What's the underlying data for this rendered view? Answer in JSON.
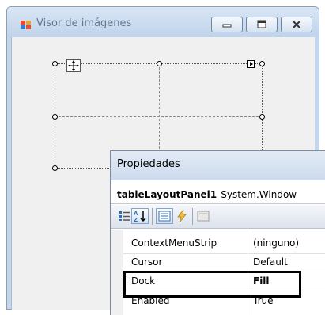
{
  "window": {
    "title": "Visor de imágenes",
    "buttons": [
      "minimize",
      "maximize",
      "close"
    ]
  },
  "designer": {
    "control": "tableLayoutPanel"
  },
  "properties_window": {
    "title": "Propiedades",
    "object_name": "tableLayoutPanel1",
    "object_type": "System.Window",
    "toolbar": [
      {
        "name": "categorized-icon",
        "active": false
      },
      {
        "name": "alphabetical-icon",
        "active": true
      },
      {
        "name": "properties-icon",
        "active": true
      },
      {
        "name": "events-icon",
        "active": false
      },
      {
        "name": "property-pages-icon",
        "active": false
      }
    ],
    "rows": [
      {
        "name": "ContextMenuStrip",
        "value": "(ninguno)",
        "bold_value": false
      },
      {
        "name": "Cursor",
        "value": "Default",
        "bold_value": false
      },
      {
        "name": "Dock",
        "value": "Fill",
        "bold_value": true,
        "highlighted": true
      },
      {
        "name": "Enabled",
        "value": "True",
        "bold_value": false
      }
    ]
  },
  "colors": {
    "titlebar": "#c3d6ec",
    "highlight_border": "#000000"
  }
}
